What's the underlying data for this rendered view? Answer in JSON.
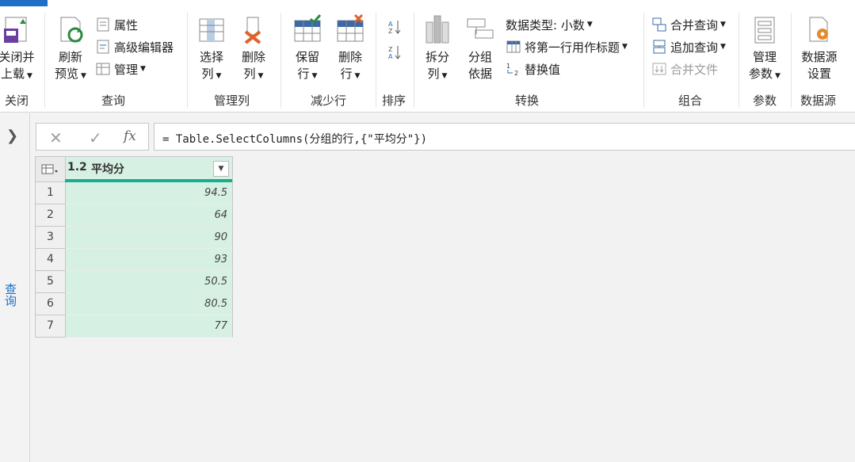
{
  "ribbon": {
    "close_load": [
      "关闭并",
      "上载"
    ],
    "refresh_preview": [
      "刷新",
      "预览"
    ],
    "properties": "属性",
    "advanced_editor": "高级编辑器",
    "manage": "管理",
    "choose_columns": [
      "选择",
      "列"
    ],
    "remove_columns": [
      "删除",
      "列"
    ],
    "keep_rows": [
      "保留",
      "行"
    ],
    "remove_rows": [
      "删除",
      "行"
    ],
    "split_column": [
      "拆分",
      "列"
    ],
    "group_by": [
      "分组",
      "依据"
    ],
    "data_type": "数据类型: 小数",
    "use_first_row": "将第一行用作标题",
    "replace_values": "替换值",
    "merge_queries": "合并查询",
    "append_queries": "追加查询",
    "combine_files": "合并文件",
    "manage_params": [
      "管理",
      "参数"
    ],
    "datasource_settings": [
      "数据源",
      "设置"
    ],
    "groups": {
      "close": "关闭",
      "query": "查询",
      "manage_columns": "管理列",
      "reduce_rows": "减少行",
      "sort": "排序",
      "transform": "转换",
      "combine": "组合",
      "parameters": "参数",
      "data_source": "数据源"
    }
  },
  "leftpane": {
    "label": "查询",
    "expand_icon": "chevron-right-icon"
  },
  "formula_bar": {
    "cancel_icon": "close-icon",
    "confirm_icon": "check-icon",
    "fx_label": "fx",
    "formula": "= Table.SelectColumns(分组的行,{\"平均分\"})"
  },
  "table": {
    "column": {
      "type_label": "1.2",
      "name": "平均分"
    },
    "rows": [
      {
        "n": "1",
        "v": "94.5"
      },
      {
        "n": "2",
        "v": "64"
      },
      {
        "n": "3",
        "v": "90"
      },
      {
        "n": "4",
        "v": "93"
      },
      {
        "n": "5",
        "v": "50.5"
      },
      {
        "n": "6",
        "v": "80.5"
      },
      {
        "n": "7",
        "v": "77"
      }
    ]
  },
  "colors": {
    "accent": "#1d6fc7",
    "column_fill": "#d7f0e4",
    "column_bar": "#17b08c"
  }
}
